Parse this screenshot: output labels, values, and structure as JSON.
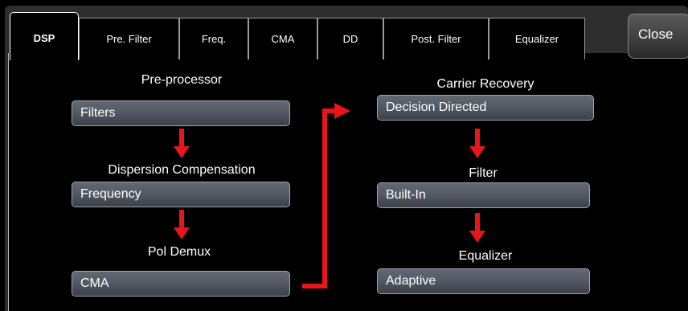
{
  "tabs": [
    {
      "label": "DSP",
      "active": true
    },
    {
      "label": "Pre. Filter",
      "active": false
    },
    {
      "label": "Freq.",
      "active": false
    },
    {
      "label": "CMA",
      "active": false
    },
    {
      "label": "DD",
      "active": false
    },
    {
      "label": "Post. Filter",
      "active": false
    },
    {
      "label": "Equalizer",
      "active": false
    }
  ],
  "close_label": "Close",
  "left_chain": {
    "preprocessor": {
      "title": "Pre-processor",
      "value": "Filters"
    },
    "dispersion": {
      "title": "Dispersion Compensation",
      "value": "Frequency"
    },
    "pol_demux": {
      "title": "Pol Demux",
      "value": "CMA"
    }
  },
  "right_chain": {
    "carrier_recovery": {
      "title": "Carrier Recovery",
      "value": "Decision Directed"
    },
    "filter": {
      "title": "Filter",
      "value": "Built-In"
    },
    "equalizer": {
      "title": "Equalizer",
      "value": "Adaptive"
    }
  },
  "colors": {
    "arrow": "#e8161b",
    "field_top": "#626874",
    "field_bottom": "#3a3f48"
  }
}
